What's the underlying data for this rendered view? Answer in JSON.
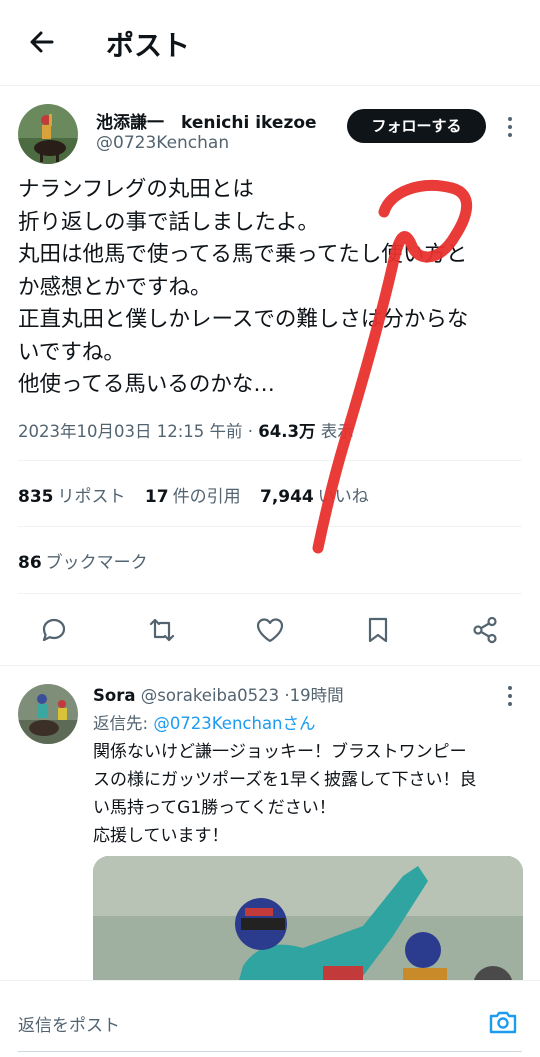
{
  "header": {
    "title": "ポスト",
    "back_icon": "arrow-left-icon"
  },
  "author": {
    "name": "池添謙一　kenichi ikezoe",
    "handle": "@0723Kenchan",
    "follow_label": "フォローする"
  },
  "tweet": {
    "lines": [
      "ナランフレグの丸田とは",
      "折り返しの事で話しましたよ。",
      "丸田は他馬で使ってる馬で乗ってたし使い方と",
      "か感想とかですね。",
      "正直丸田と僕しかレースでの難しさは分からな",
      "いですね。",
      "他使ってる馬いるのかな…"
    ],
    "timestamp": "2023年10月03日 12:15 午前",
    "separator": "·",
    "views_count": "64.3万",
    "views_label": "表示"
  },
  "stats": {
    "reposts_count": "835",
    "reposts_label": "リポスト",
    "quotes_count": "17",
    "quotes_label": "件の引用",
    "likes_count": "7,944",
    "likes_label": "いいね",
    "bookmarks_count": "86",
    "bookmarks_label": "ブックマーク"
  },
  "actions": [
    "reply-icon",
    "repost-icon",
    "like-icon",
    "bookmark-icon",
    "share-icon"
  ],
  "reply": {
    "name": "Sora",
    "handle": "@sorakeiba0523",
    "separator": "·",
    "time": "19時間",
    "reply_to_label": "返信先:",
    "reply_to_handle": "@0723Kenchanさん",
    "lines": [
      "関係ないけど謙一ジョッキー！ブラストワンピー",
      "スの様にガッツポーズを1早く披露して下さい！良",
      "い馬持ってG1勝ってください！",
      "応援しています！"
    ]
  },
  "composer": {
    "placeholder": "返信をポスト",
    "camera_icon": "camera-icon"
  },
  "colors": {
    "text": "#0f1419",
    "muted": "#536471",
    "accent": "#1d9bf0",
    "annotation": "#e8322d"
  }
}
